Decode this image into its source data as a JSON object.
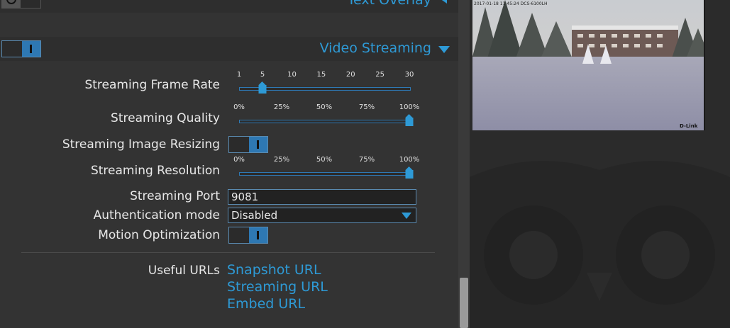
{
  "sections": {
    "text_overlay": "Text Overlay",
    "video_streaming": "Video Streaming"
  },
  "fields": {
    "frame_rate": {
      "label": "Streaming Frame Rate",
      "ticks": [
        "1",
        "5",
        "10",
        "15",
        "20",
        "25",
        "30"
      ],
      "value": 5
    },
    "quality": {
      "label": "Streaming Quality",
      "ticks": [
        "0%",
        "25%",
        "50%",
        "75%",
        "100%"
      ],
      "value": 100
    },
    "resizing": {
      "label": "Streaming Image Resizing",
      "state": "on"
    },
    "resolution": {
      "label": "Streaming Resolution",
      "ticks": [
        "0%",
        "25%",
        "50%",
        "75%",
        "100%"
      ],
      "value": 100
    },
    "port": {
      "label": "Streaming Port",
      "value": "9081"
    },
    "auth": {
      "label": "Authentication mode",
      "value": "Disabled"
    },
    "motion": {
      "label": "Motion Optimization",
      "state": "on"
    }
  },
  "urls": {
    "label": "Useful URLs",
    "snapshot": "Snapshot URL",
    "streaming": "Streaming URL",
    "embed": "Embed URL"
  },
  "camera": {
    "timestamp": "2017-01-18 11:45:24 DCS-6100LH",
    "watermark": "D-Link"
  },
  "colors": {
    "accent": "#2e9ad6",
    "panel": "#333333",
    "background": "#2b2b2b"
  }
}
